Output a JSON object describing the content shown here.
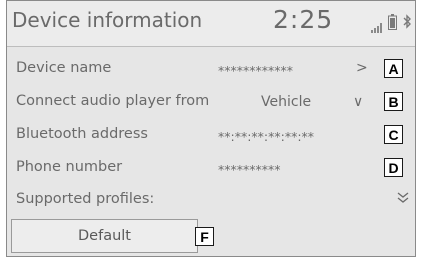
{
  "header": {
    "title": "Device information",
    "clock": "2:25"
  },
  "rows": [
    {
      "label": "Device name",
      "value": "************",
      "chevron": ">"
    },
    {
      "label": "Connect audio player from",
      "value": "Vehicle",
      "chevron": "∨"
    },
    {
      "label": "Bluetooth address",
      "value": "**:**:**:**:**:**"
    },
    {
      "label": "Phone number",
      "value": "**********"
    }
  ],
  "supported": {
    "label": "Supported profiles:"
  },
  "default_button": {
    "label": "Default"
  },
  "callouts": [
    "A",
    "B",
    "C",
    "D",
    "F"
  ],
  "colors": {
    "text": "#6a6a6a",
    "background": "#e6e6e6"
  },
  "icons": [
    "signal-icon",
    "battery-icon",
    "bluetooth-icon",
    "chevron-right-icon",
    "chevron-down-icon",
    "double-chevron-down-icon"
  ]
}
